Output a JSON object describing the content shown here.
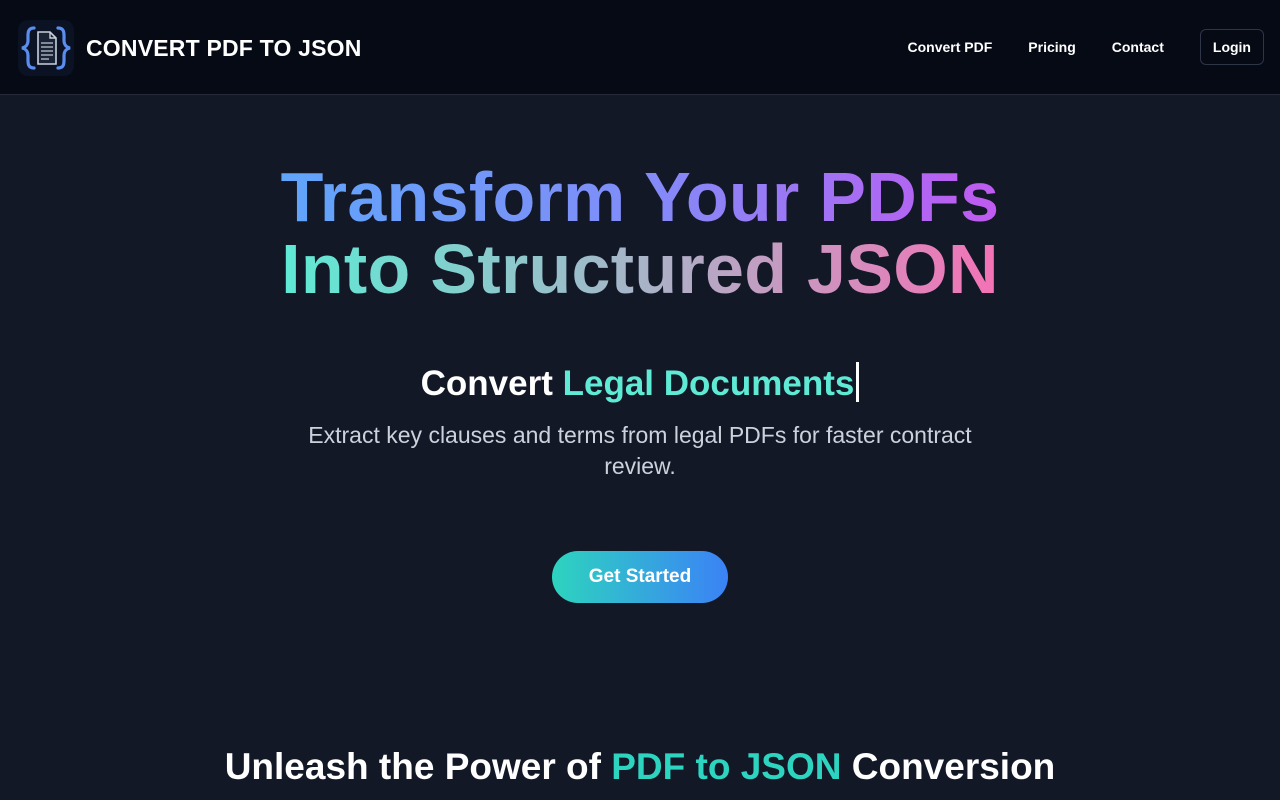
{
  "header": {
    "brand": "CONVERT PDF TO JSON",
    "logo_icon": "json-braces-document-icon",
    "nav": [
      {
        "label": "Convert PDF"
      },
      {
        "label": "Pricing"
      },
      {
        "label": "Contact"
      }
    ],
    "login_label": "Login"
  },
  "hero": {
    "line1_parts": [
      "Transform Your PDFs"
    ],
    "line2_parts": [
      "Into Structured JSON"
    ],
    "subhead_prefix": "Convert ",
    "subhead_highlight": "Legal Documents",
    "description": "Extract key clauses and terms from legal PDFs for faster contract review.",
    "cta_label": "Get Started"
  },
  "section": {
    "title_before": "Unleash the Power of ",
    "title_highlight": "PDF to JSON",
    "title_after": " Conversion"
  },
  "colors": {
    "background": "#131827",
    "header_background": "#050a15",
    "accent_teal": "#2dd4bf",
    "accent_blue": "#3b82f6"
  }
}
